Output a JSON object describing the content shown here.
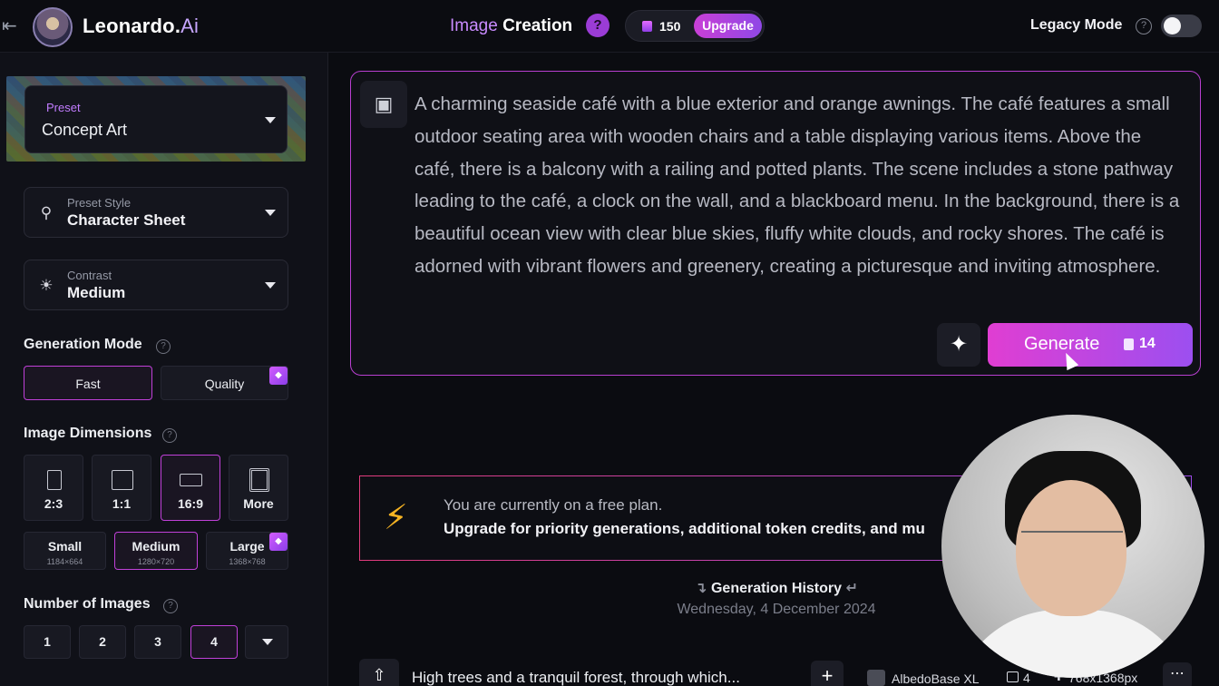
{
  "header": {
    "back_icon": "arrow-left-icon",
    "brand": "Leonardo.",
    "brand_suffix": "Ai",
    "page_title_a": "Image",
    "page_title_b": "Creation",
    "help_label": "?",
    "tokens": "150",
    "upgrade_label": "Upgrade",
    "legacy_label": "Legacy Mode",
    "legacy_help": "?"
  },
  "sidebar": {
    "preset": {
      "label": "Preset",
      "value": "Concept Art"
    },
    "preset_style": {
      "label": "Preset Style",
      "value": "Character Sheet",
      "icon": "flask-icon"
    },
    "contrast": {
      "label": "Contrast",
      "value": "Medium",
      "icon": "sun-icon"
    },
    "generation_mode": {
      "title": "Generation Mode",
      "options": [
        "Fast",
        "Quality"
      ],
      "selected": "Fast"
    },
    "image_dimensions": {
      "title": "Image Dimensions",
      "ratios": [
        "2:3",
        "1:1",
        "16:9",
        "More"
      ],
      "selected_ratio": "16:9",
      "sizes": [
        {
          "label": "Small",
          "sub": "1184×664"
        },
        {
          "label": "Medium",
          "sub": "1280×720"
        },
        {
          "label": "Large",
          "sub": "1368×768"
        }
      ],
      "selected_size": "Medium"
    },
    "number_of_images": {
      "title": "Number of Images",
      "options": [
        "1",
        "2",
        "3",
        "4"
      ],
      "selected": "4"
    }
  },
  "prompt": {
    "text": "A charming seaside café with a blue exterior and orange awnings. The café features a small outdoor seating area with wooden chairs and a table displaying various items. Above the café, there is a balcony with a railing and potted plants. The scene includes a stone pathway leading to the café, a clock on the wall, and a blackboard menu. In the background, there is a beautiful ocean view with clear blue skies, fluffy white clouds, and rocky shores. The café is adorned with vibrant flowers and greenery, creating a picturesque and inviting atmosphere.",
    "generate_label": "Generate",
    "generate_cost": "14"
  },
  "banner": {
    "line1": "You are currently on a free plan.",
    "line2": "Upgrade for priority generations, additional token credits, and mu"
  },
  "history": {
    "title": "Generation History",
    "date": "Wednesday, 4 December 2024"
  },
  "history_item": {
    "prompt": "High trees and a tranquil forest, through which...",
    "model": "AlbedoBase XL",
    "count": "4",
    "resolution": "768x1368px"
  },
  "colors": {
    "accent": "#c040d8",
    "generate_start": "#e03ed2",
    "generate_end": "#9c4ff0",
    "bolt": "#f5b323"
  }
}
